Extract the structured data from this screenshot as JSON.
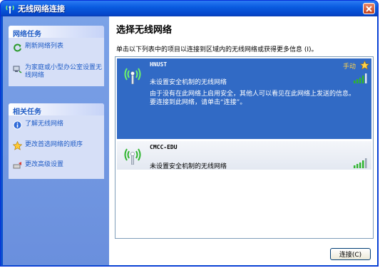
{
  "window": {
    "title": "无线网络连接"
  },
  "sidebar": {
    "network_tasks": {
      "title": "网络任务",
      "items": [
        {
          "label": "刷新网络列表",
          "icon": "refresh-icon"
        },
        {
          "label": "为家庭或小型办公室设置无线网络",
          "icon": "setup-network-icon"
        }
      ]
    },
    "related_tasks": {
      "title": "相关任务",
      "items": [
        {
          "label": "了解无线网络",
          "icon": "info-icon"
        },
        {
          "label": "更改首选网络的顺序",
          "icon": "star-icon"
        },
        {
          "label": "更改高级设置",
          "icon": "settings-icon"
        }
      ]
    }
  },
  "main": {
    "heading": "选择无线网络",
    "instruction": "单击以下列表中的项目以连接到区域内的无线网络或获得更多信息 (I)。",
    "networks": [
      {
        "ssid": "HNUST",
        "security": "未设置安全机制的无线网络",
        "badge": "手动",
        "description": "由于没有在此网络上启用安全，其他人可以看见在此网络上发送的信息。要连接到此网络，请单击“连接”。",
        "selected": true
      },
      {
        "ssid": "CMCC-EDU",
        "security": "未设置安全机制的无线网络",
        "selected": false
      }
    ],
    "connect_label": "连接(C)"
  },
  "colors": {
    "titlebar": "#0a5ce0",
    "selected_row": "#316ac5",
    "task_link": "#215dc6",
    "signal_green": "#2fb52f"
  }
}
